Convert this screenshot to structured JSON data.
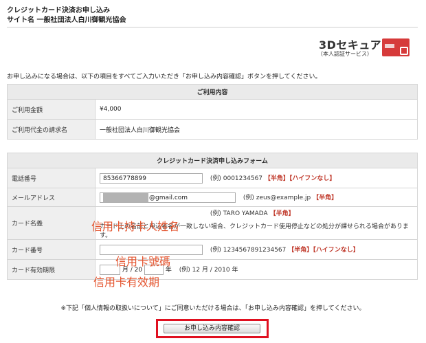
{
  "header": {
    "line1": "クレジットカード決済お申し込み",
    "line2": "サイト名 一般社団法人白川御観光協会"
  },
  "logo": {
    "title": "3Dセキュア",
    "subtitle": "（本人認証サービス）",
    "accent_color": "#d63a3a"
  },
  "intro": "お申し込みになる場合は、以下の項目をすべてご入力いただき「お申し込み内容確認」ボタンを押してください。",
  "usage": {
    "title": "ご利用内容",
    "rows": [
      {
        "label": "ご利用金額",
        "value": "¥4,000"
      },
      {
        "label": "ご利用代金の請求名",
        "value": "一般社団法人白川御観光協会"
      }
    ]
  },
  "form": {
    "title": "クレジットカード決済申し込みフォーム",
    "phone": {
      "label": "電話番号",
      "value": "85366778899",
      "example": "(例) 0001234567",
      "note": "【半角】【ハイフンなし】"
    },
    "email": {
      "label": "メールアドレス",
      "value": "@gmail.com",
      "example": "(例) zeus@example.jp",
      "note": "【半角】"
    },
    "card_name": {
      "label": "カード名義",
      "overlay": "信用卡持卡人姓名",
      "example": "(例) TARO YAMADA",
      "note": "【半角】",
      "hint": "カード上の名前と申込者名が一致しない場合、クレジットカード使用停止などの処分が課せられる場合があります。"
    },
    "card_number": {
      "label": "カード番号",
      "overlay": "信用卡號碼",
      "example": "(例) 1234567891234567",
      "note": "【半角】【ハイフンなし】"
    },
    "expiry": {
      "label": "カード有効期限",
      "overlay": "信用卡有效期",
      "month_sep": "月 /",
      "year_prefix": "20",
      "year_suffix": "年",
      "example": "(例) 12 月 / 2010 年"
    }
  },
  "consent_note": "※下記「個人情報の取扱いについて」にご同意いただける場合は、「お申し込み内容確認」を押してください。",
  "submit_label": "お申し込み内容確認"
}
